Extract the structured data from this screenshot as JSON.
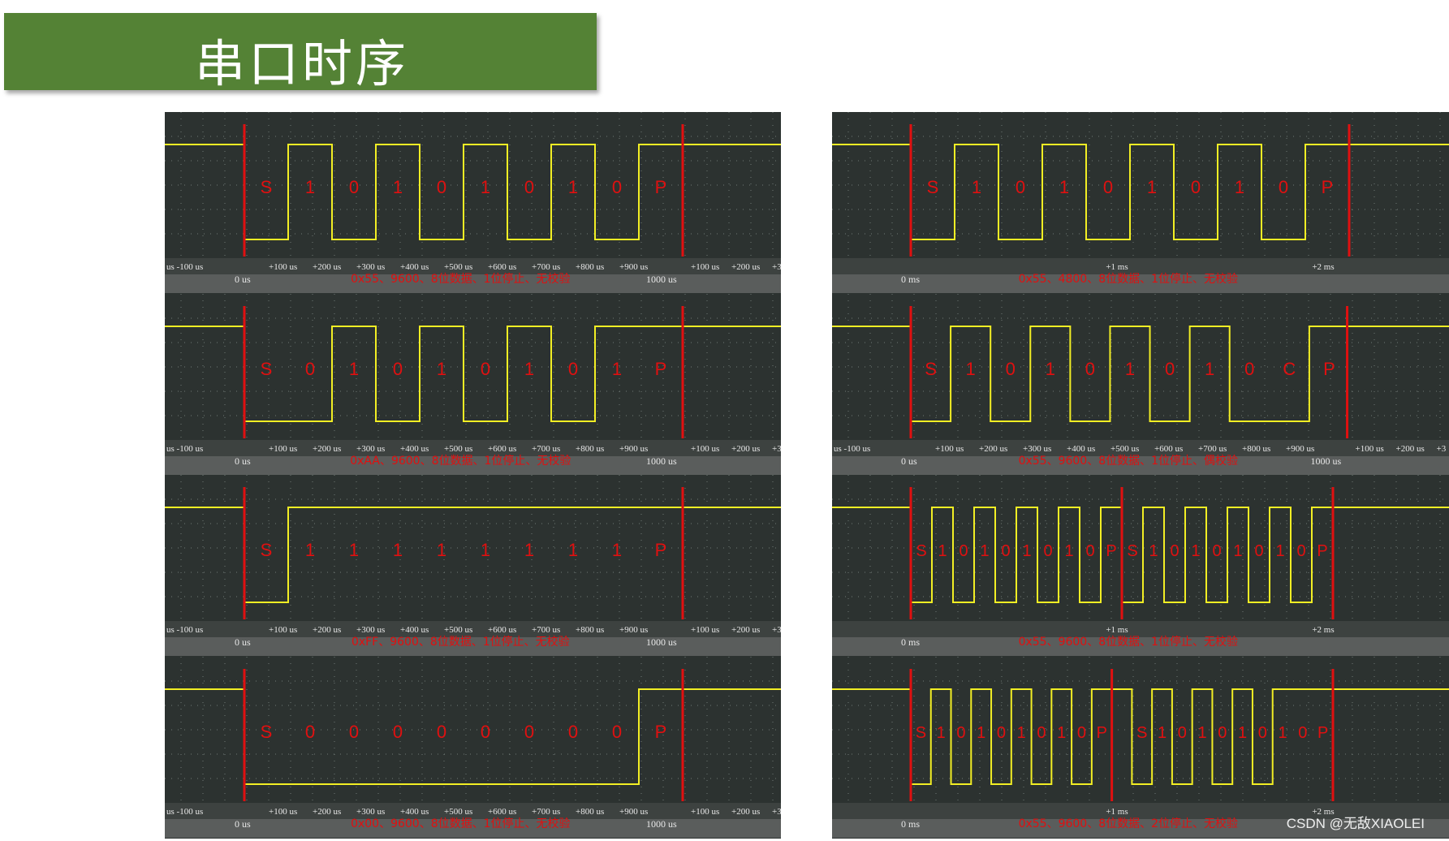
{
  "title": "串口时序",
  "watermark": "CSDN @无敌XIAOLEI",
  "colors": {
    "title_bg": "#548235",
    "scope_bg": "#2c3230",
    "signal": "#f2ee24",
    "marker": "#e01010",
    "label": "#e01010",
    "axis_bg": "#5a5d5c",
    "axis_text": "#e8e8e8"
  },
  "us_ticks": [
    "us -100 us",
    "+100 us",
    "+200 us",
    "+300 us",
    "+400 us",
    "+500 us",
    "+600 us",
    "+700 us",
    "+800 us",
    "+900 us",
    "+100 us",
    "+200 us",
    "+3"
  ],
  "ms_ticks": [
    "+1 ms",
    "+2 ms"
  ],
  "left": [
    {
      "bits": "0101010101",
      "labels": [
        "S",
        "1",
        "0",
        "1",
        "0",
        "1",
        "0",
        "1",
        "0",
        "P"
      ],
      "caption": "0x55、9600、8位数据、1位停止、无校验",
      "zero": "0 us",
      "end": "1000 us"
    },
    {
      "bits": "0010101011",
      "labels": [
        "S",
        "0",
        "1",
        "0",
        "1",
        "0",
        "1",
        "0",
        "1",
        "P"
      ],
      "caption": "0xAA、9600、8位数据、1位停止、无校验",
      "zero": "0 us",
      "end": "1000 us"
    },
    {
      "bits": "0111111111",
      "labels": [
        "S",
        "1",
        "1",
        "1",
        "1",
        "1",
        "1",
        "1",
        "1",
        "P"
      ],
      "caption": "0xFF、9600、8位数据、1位停止、无校验",
      "zero": "0 us",
      "end": "1000 us"
    },
    {
      "bits": "0000000001",
      "labels": [
        "S",
        "0",
        "0",
        "0",
        "0",
        "0",
        "0",
        "0",
        "0",
        "P"
      ],
      "caption": "0x00、9600、8位数据、1位停止、无校验",
      "zero": "0 us",
      "end": "1000 us"
    }
  ],
  "right": [
    {
      "bits": "0101010101",
      "labels": [
        "S",
        "1",
        "0",
        "1",
        "0",
        "1",
        "0",
        "1",
        "0",
        "P"
      ],
      "caption": "0x55、4800、8位数据、1位停止、无校验",
      "zero": "0 ms"
    },
    {
      "bits": "01010101001",
      "labels": [
        "S",
        "1",
        "0",
        "1",
        "0",
        "1",
        "0",
        "1",
        "0",
        "C",
        "P"
      ],
      "caption": "0x55、9600、8位数据、1位停止、偶校验",
      "zero": "0 us",
      "end": "1000 us"
    },
    {
      "bits": "01010101010101010101",
      "labels": [
        "S",
        "1",
        "0",
        "1",
        "0",
        "1",
        "0",
        "1",
        "0",
        "P",
        "S",
        "1",
        "0",
        "1",
        "0",
        "1",
        "0",
        "1",
        "0",
        "P"
      ],
      "caption": "0x55、9600、8位数据、1位停止、无校验",
      "zero": "0 ms"
    },
    {
      "bits": "010101010110101010111",
      "labels": [
        "S",
        "1",
        "0",
        "1",
        "0",
        "1",
        "0",
        "1",
        "0",
        "P",
        "",
        "S",
        "1",
        "0",
        "1",
        "0",
        "1",
        "0",
        "1",
        "0",
        "P"
      ],
      "caption": "0x55、9600、8位数据、2位停止、无校验",
      "zero": "0 ms"
    }
  ]
}
